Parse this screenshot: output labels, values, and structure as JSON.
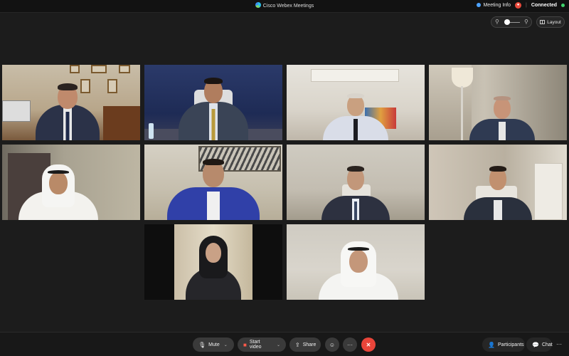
{
  "window": {
    "title": "Cisco Webex Meetings"
  },
  "header": {
    "meeting_info_label": "Meeting Info",
    "connection_status": "Connected",
    "layout_label": "Layout"
  },
  "toolbar": {
    "mute_label": "Mute",
    "start_video_label": "Start video",
    "share_label": "Share",
    "participants_label": "Participants",
    "chat_label": "Chat",
    "more_label": "···",
    "end_label": "✕"
  },
  "colors": {
    "end_call": "#e9453a",
    "connected_dot": "#3fd36b",
    "accent": "#4da3ff"
  },
  "icons": [
    "webex-logo-icon",
    "info-icon",
    "record-icon",
    "zoom-out-icon",
    "zoom-in-icon",
    "layout-grid-icon",
    "microphone-icon",
    "camera-icon",
    "share-icon",
    "emoji-icon",
    "more-icon",
    "end-call-icon",
    "participants-icon",
    "chat-icon"
  ]
}
